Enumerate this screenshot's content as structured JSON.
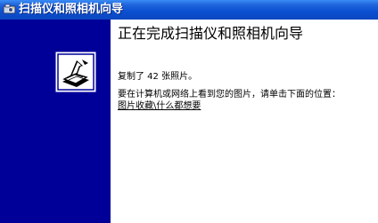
{
  "window": {
    "title": "扫描仪和照相机向导"
  },
  "content": {
    "heading": "正在完成扫描仪和照相机向导",
    "copied_text": "复制了 42 张照片。",
    "instruction": "要在计算机或网络上看到您的图片，请单击下面的位置：",
    "link_text": "图片收藏\\什么都想要"
  },
  "colors": {
    "left_panel": "#000099",
    "titlebar": "#0a4fd0"
  },
  "icons": {
    "title_icon": "scanner-camera-icon",
    "wizard_logo": "wizard-arrow-icon"
  }
}
